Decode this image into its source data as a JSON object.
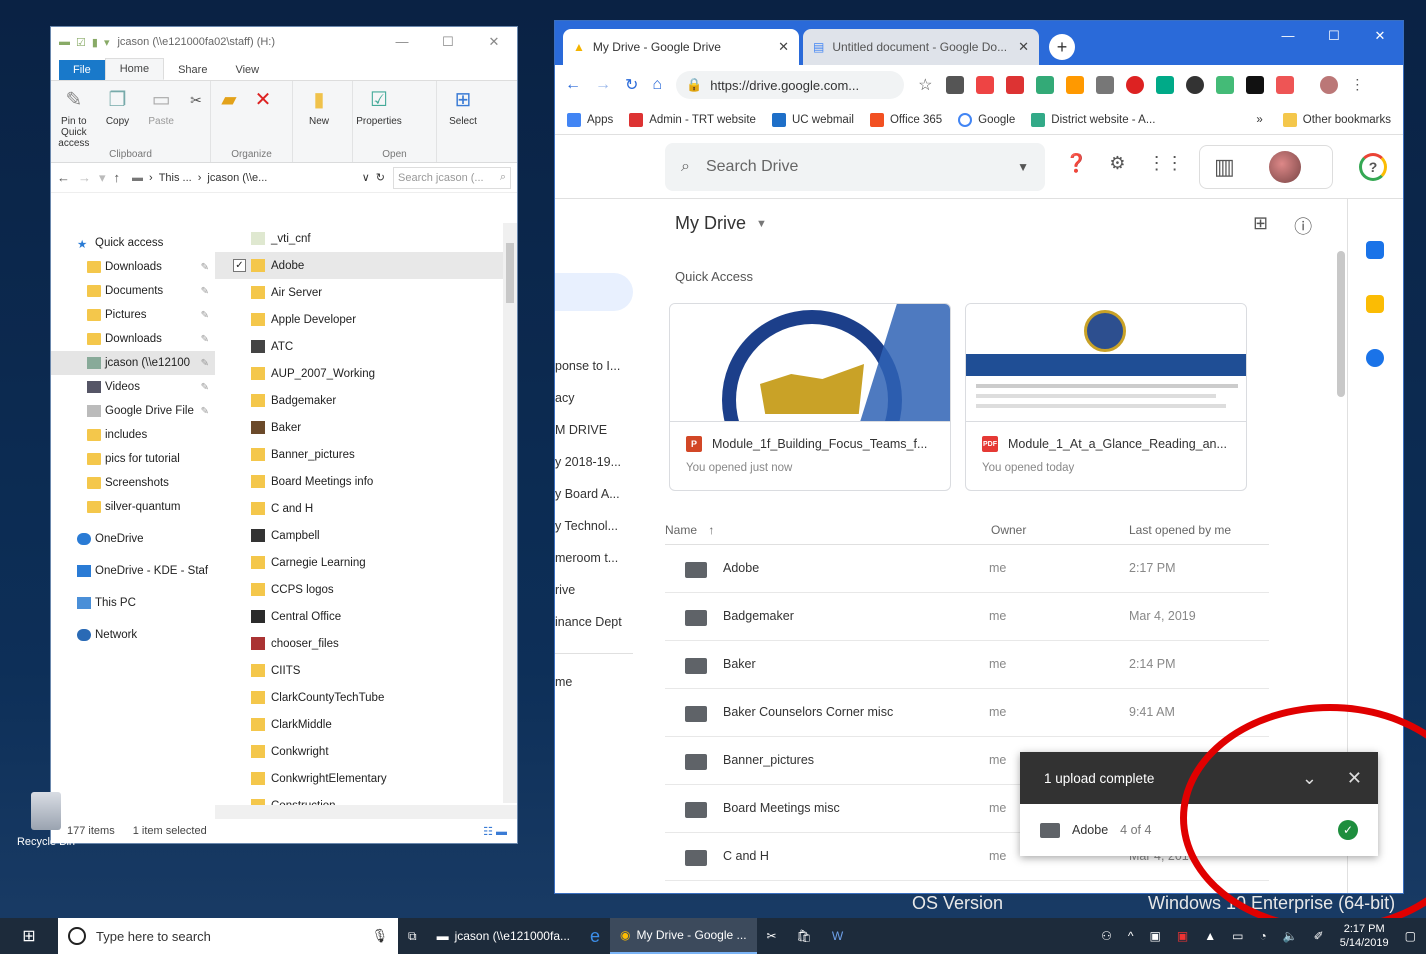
{
  "explorer": {
    "title": "jcason (\\\\e121000fa02\\staff) (H:)",
    "tabs": [
      "File",
      "Home",
      "Share",
      "View"
    ],
    "ribbon": {
      "clipboard": {
        "name": "Clipboard",
        "pin": "Pin to Quick access",
        "copy": "Copy",
        "paste": "Paste"
      },
      "organize": {
        "name": "Organize"
      },
      "new": {
        "name": "New",
        "label": "New"
      },
      "open": {
        "name": "Open",
        "properties": "Properties"
      },
      "select": {
        "label": "Select"
      }
    },
    "address": {
      "crumb1": "This ...",
      "crumb2": "jcason (\\\\e...",
      "search_placeholder": "Search jcason (..."
    },
    "nav": [
      {
        "label": "Quick access"
      },
      {
        "label": "Downloads"
      },
      {
        "label": "Documents"
      },
      {
        "label": "Pictures"
      },
      {
        "label": "Downloads"
      },
      {
        "label": "jcason (\\\\e12100"
      },
      {
        "label": "Videos"
      },
      {
        "label": "Google Drive File"
      },
      {
        "label": "includes"
      },
      {
        "label": "pics for tutorial"
      },
      {
        "label": "Screenshots"
      },
      {
        "label": "silver-quantum"
      },
      {
        "label": "OneDrive"
      },
      {
        "label": "OneDrive - KDE - Staf"
      },
      {
        "label": "This PC"
      },
      {
        "label": "Network"
      }
    ],
    "files": [
      "_vti_cnf",
      "Adobe",
      "Air Server",
      "Apple Developer",
      "ATC",
      "AUP_2007_Working",
      "Badgemaker",
      "Baker",
      "Banner_pictures",
      "Board Meetings info",
      "C and H",
      "Campbell",
      "Carnegie Learning",
      "CCPS logos",
      "Central Office",
      "chooser_files",
      "CIITS",
      "ClarkCountyTechTube",
      "ClarkMiddle",
      "Conkwright",
      "ConkwrightElementary",
      "Construction"
    ],
    "status": {
      "items": "177 items",
      "selected": "1 item selected"
    }
  },
  "chrome": {
    "tabs": [
      {
        "title": "My Drive - Google Drive"
      },
      {
        "title": "Untitled document - Google Do..."
      }
    ],
    "url": "https://drive.google.com...",
    "bookmarks": [
      "Apps",
      "Admin - TRT website",
      "UC webmail",
      "Office 365",
      "Google",
      "District website - A...",
      "Other bookmarks"
    ],
    "accent": "#2a6ad9"
  },
  "drive": {
    "search_placeholder": "Search Drive",
    "heading": "My Drive",
    "quick_access": "Quick Access",
    "left_nav": [
      "ponse to I...",
      "acy",
      "M DRIVE",
      "y 2018-19...",
      "y Board A...",
      "y Technol...",
      "meroom t...",
      "rive",
      "inance Dept",
      "me"
    ],
    "cards": [
      {
        "name": "Module_1f_Building_Focus_Teams_f...",
        "sub": "You opened just now",
        "badge": "P"
      },
      {
        "name": "Module_1_At_a_Glance_Reading_an...",
        "sub": "You opened today",
        "badge": "PDF"
      }
    ],
    "columns": {
      "name": "Name",
      "owner": "Owner",
      "last": "Last opened by me"
    },
    "rows": [
      {
        "name": "Adobe",
        "owner": "me",
        "date": "2:17 PM"
      },
      {
        "name": "Badgemaker",
        "owner": "me",
        "date": "Mar 4, 2019"
      },
      {
        "name": "Baker",
        "owner": "me",
        "date": "2:14 PM"
      },
      {
        "name": "Baker Counselors Corner misc",
        "owner": "me",
        "date": "9:41 AM"
      },
      {
        "name": "Banner_pictures",
        "owner": "me",
        "date": ""
      },
      {
        "name": "Board Meetings misc",
        "owner": "me",
        "date": ""
      },
      {
        "name": "C and H",
        "owner": "me",
        "date": "Mar 4, 2019"
      }
    ],
    "upload": {
      "title": "1 upload complete",
      "item": "Adobe",
      "count": "4 of 4"
    }
  },
  "desktop": {
    "recycle": "Recycle Bin",
    "os_label": "OS Version",
    "os_value": "Windows 10 Enterprise (64-bit)"
  },
  "taskbar": {
    "search_placeholder": "Type here to search",
    "items": [
      "jcason (\\\\e121000fa...",
      "My Drive - Google ..."
    ],
    "time": "2:17 PM",
    "date": "5/14/2019"
  }
}
